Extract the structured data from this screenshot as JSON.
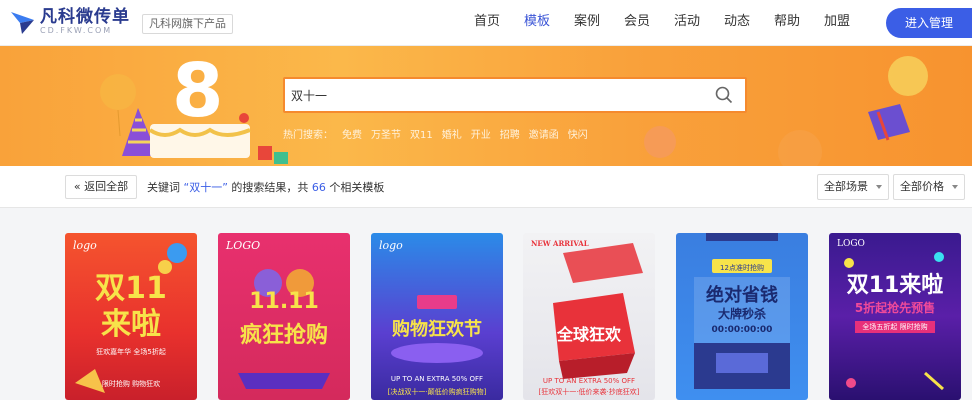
{
  "header": {
    "logo_title": "凡科微传单",
    "logo_sub": "CD.FKW.COM",
    "slogan": "凡科网旗下产品",
    "nav": [
      "首页",
      "模板",
      "案例",
      "会员",
      "活动",
      "动态",
      "帮助",
      "加盟"
    ],
    "active_nav": "模板",
    "admin_button": "进入管理"
  },
  "banner": {
    "search_value": "双十一",
    "hot_label": "热门搜索：",
    "hot_tags": [
      "免费",
      "万圣节",
      "双11",
      "婚礼",
      "开业",
      "招聘",
      "邀请函",
      "快闪"
    ]
  },
  "filter": {
    "back_label": "返回全部",
    "result_prefix": "关键词",
    "keyword": "“双十一”",
    "result_mid": "的搜索结果，共",
    "count": "66",
    "result_suffix": "个相关模板",
    "scene_select": "全部场景",
    "price_select": "全部价格"
  },
  "cards": [
    {
      "logo": "logo",
      "title": "双11",
      "title2": "来啦",
      "line1": "狂欢嘉年华 全场5折起",
      "line2": "限时抢购 购物狂欢"
    },
    {
      "logo": "LOGO",
      "title": "11.11",
      "title2": "疯狂抢购",
      "line1": "",
      "line2": ""
    },
    {
      "logo": "logo",
      "title": "购物狂欢节",
      "title2": "",
      "line1": "UP TO AN EXTRA 50% OFF",
      "line2": "[决战双十一·颠低价购疯狂购物]"
    },
    {
      "logo": "NEW ARRIVAL",
      "title": "全球狂欢",
      "title2": "",
      "line1": "UP TO AN EXTRA 50% OFF",
      "line2": "[狂欢双十一·低价来袭·抄底狂欢]"
    },
    {
      "logo": "",
      "title": "绝对省钱",
      "title2": "大牌秒杀",
      "line1": "12点准时抢购",
      "line2": "00:00:00:00"
    },
    {
      "logo": "LOGO",
      "title": "双11来啦",
      "title2": "5折起抢先预售",
      "line1": "全场五折起 限时抢购",
      "line2": ""
    }
  ],
  "colors": {
    "accent": "#3b5ee6",
    "banner": "#f9a23a"
  }
}
